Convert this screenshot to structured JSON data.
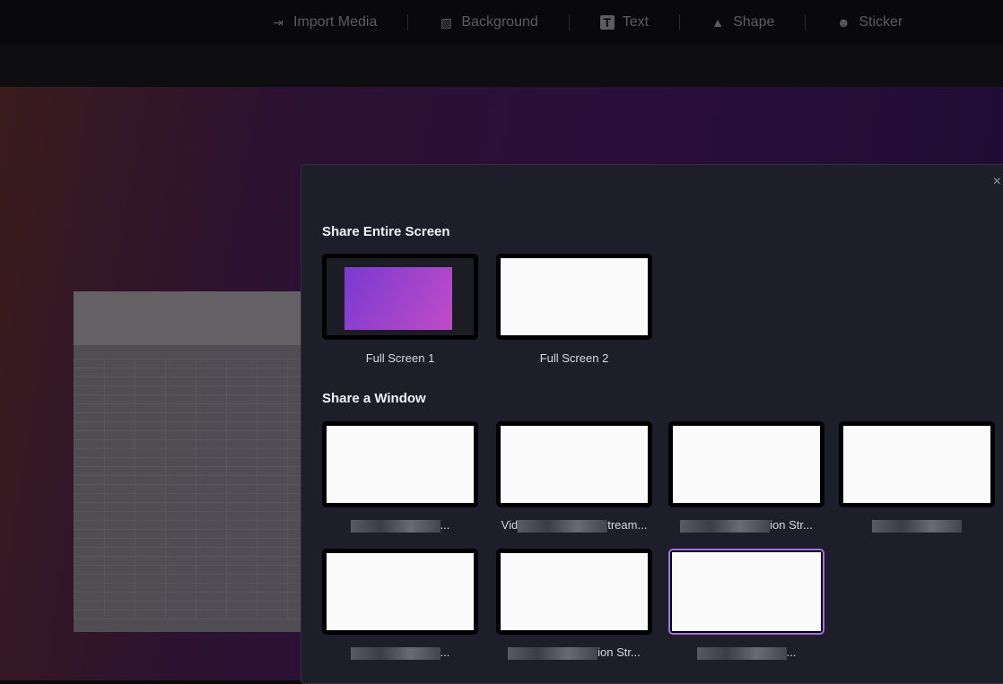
{
  "toolbar": {
    "items": [
      {
        "label": "Import Media",
        "icon": "import-icon"
      },
      {
        "label": "Background",
        "icon": "background-icon"
      },
      {
        "label": "Text",
        "icon": "text-icon"
      },
      {
        "label": "Shape",
        "icon": "shape-icon"
      },
      {
        "label": "Sticker",
        "icon": "sticker-icon"
      }
    ]
  },
  "dialog": {
    "close_icon": "×",
    "screens_title": "Share Entire Screen",
    "screens": [
      {
        "label": "Full Screen 1"
      },
      {
        "label": "Full Screen 2"
      }
    ],
    "windows_title": "Share a Window",
    "windows": [
      {
        "label_pre": "",
        "label_post": "..."
      },
      {
        "label_pre": "Vid",
        "label_post": "tream..."
      },
      {
        "label_pre": "",
        "label_post": "ion Str..."
      },
      {
        "label_pre": "",
        "label_post": ""
      },
      {
        "label_pre": "",
        "label_post": "..."
      },
      {
        "label_pre": "",
        "label_post": "ion Str..."
      },
      {
        "label_pre": "",
        "label_post": "..."
      }
    ],
    "selected_window": 7,
    "accent": "#a46ee6"
  }
}
